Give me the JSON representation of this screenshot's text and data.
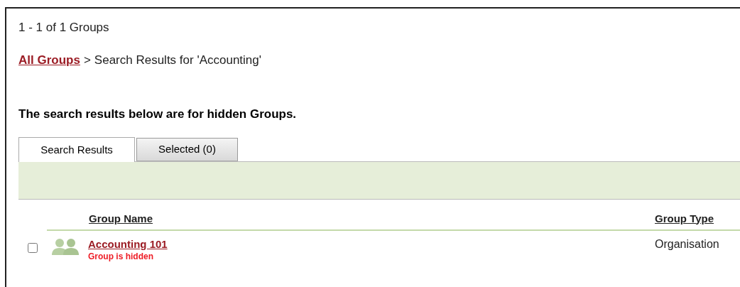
{
  "summary": "1 - 1 of 1 Groups",
  "breadcrumb": {
    "link": "All Groups",
    "separator": ">",
    "current": "Search Results for 'Accounting'"
  },
  "notice": "The search results below are for hidden Groups.",
  "tabs": [
    {
      "label": "Search Results",
      "selected": true
    },
    {
      "label": "Selected (0)",
      "selected": false
    }
  ],
  "table": {
    "columns": [
      "Group Name",
      "Group Type"
    ],
    "rows": [
      {
        "checked": false,
        "name": "Accounting 101",
        "status": "Group is hidden",
        "type": "Organisation"
      }
    ]
  }
}
